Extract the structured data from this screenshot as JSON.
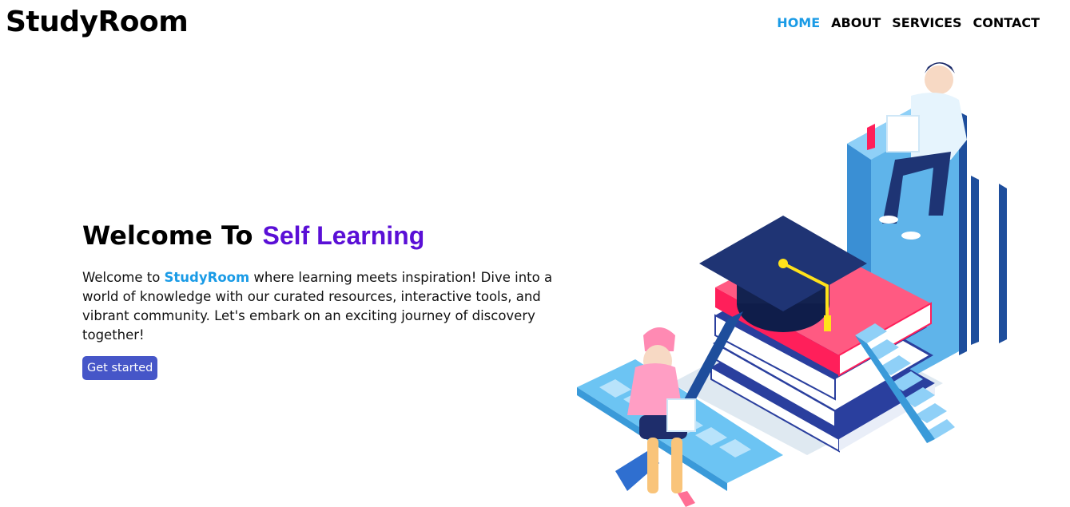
{
  "navbar": {
    "brand": "StudyRoom",
    "links": [
      {
        "label": "HOME",
        "active": true
      },
      {
        "label": "ABOUT",
        "active": false
      },
      {
        "label": "SERVICES",
        "active": false
      },
      {
        "label": "CONTACT",
        "active": false
      }
    ]
  },
  "hero": {
    "title_prefix": "Welcome To",
    "title_accent": "Self Learning",
    "text_before": "Welcome to ",
    "text_brand": "StudyRoom",
    "text_after": " where learning meets inspiration! Dive into a world of knowledge with our curated resources, interactive tools, and vibrant community. Let's embark on an exciting journey of discovery together!",
    "cta_label": "Get started"
  },
  "colors": {
    "accent_blue": "#1a9be6",
    "accent_purple": "#5a0fd6",
    "button": "#4656c8"
  },
  "illustration": {
    "icon": "study-illustration-icon"
  }
}
